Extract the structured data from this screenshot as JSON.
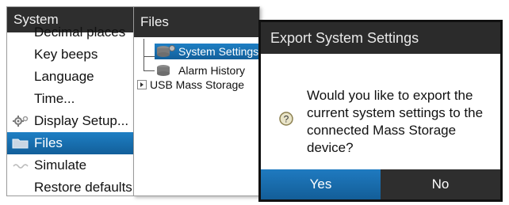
{
  "system_menu": {
    "title": "System",
    "items": [
      {
        "label": "Decimal places"
      },
      {
        "label": "Key beeps"
      },
      {
        "label": "Language"
      },
      {
        "label": "Time..."
      },
      {
        "label": "Display Setup...",
        "icon": "display-setup-gear-icon"
      },
      {
        "label": "Files",
        "icon": "folder-icon",
        "selected": true
      },
      {
        "label": "Simulate",
        "icon": "simulate-icon"
      },
      {
        "label": "Restore defaults..."
      }
    ]
  },
  "files_panel": {
    "title": "Files",
    "tree": [
      {
        "label": "System Settings",
        "icon": "database-gear-icon",
        "selected": true
      },
      {
        "label": "Alarm History",
        "icon": "database-icon"
      },
      {
        "label": "USB Mass Storage",
        "icon": "expand-arrow-icon"
      }
    ]
  },
  "dialog": {
    "title": "Export System Settings",
    "message": "Would you like to export the current system settings to the connected Mass Storage device?",
    "icon": "question-icon",
    "yes_label": "Yes",
    "no_label": "No"
  },
  "colors": {
    "selection_blue": "#1a6fb0",
    "title_bar": "#2e2e2e",
    "dialog_border": "#111111"
  }
}
